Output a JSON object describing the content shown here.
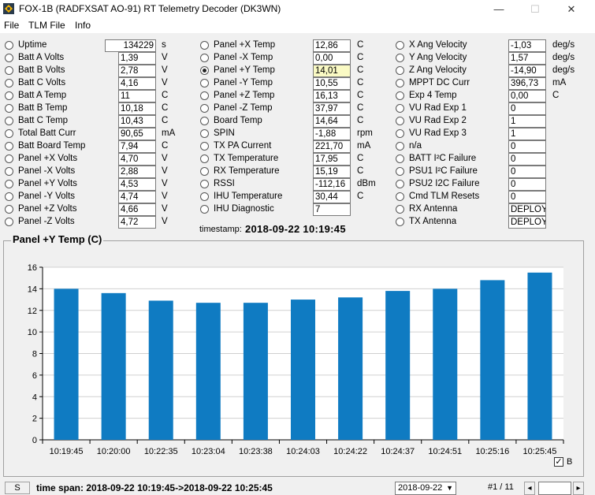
{
  "window": {
    "title": "FOX-1B (RADFXSAT AO-91) RT Telemetry Decoder  (DK3WN)",
    "min_glyph": "—",
    "max_glyph": "☐",
    "close_glyph": "✕"
  },
  "menu": [
    "File",
    "TLM File",
    "Info"
  ],
  "col1": [
    {
      "label": "Uptime",
      "value": "134229",
      "unit": "s"
    },
    {
      "label": "Batt A Volts",
      "value": "1,39",
      "unit": "V"
    },
    {
      "label": "Batt B Volts",
      "value": "2,78",
      "unit": "V"
    },
    {
      "label": "Batt C Volts",
      "value": "4,16",
      "unit": "V"
    },
    {
      "label": "Batt A Temp",
      "value": "11",
      "unit": "C"
    },
    {
      "label": "Batt B Temp",
      "value": "10,18",
      "unit": "C"
    },
    {
      "label": "Batt C Temp",
      "value": "10,43",
      "unit": "C"
    },
    {
      "label": "Total Batt Curr",
      "value": "90,65",
      "unit": "mA"
    },
    {
      "label": "Batt Board Temp",
      "value": "7,94",
      "unit": "C"
    },
    {
      "label": "Panel +X Volts",
      "value": "4,70",
      "unit": "V"
    },
    {
      "label": "Panel -X Volts",
      "value": "2,88",
      "unit": "V"
    },
    {
      "label": "Panel +Y Volts",
      "value": "4,53",
      "unit": "V"
    },
    {
      "label": "Panel -Y Volts",
      "value": "4,74",
      "unit": "V"
    },
    {
      "label": "Panel +Z Volts",
      "value": "4,66",
      "unit": "V"
    },
    {
      "label": "Panel -Z Volts",
      "value": "4,72",
      "unit": "V"
    }
  ],
  "col2": [
    {
      "label": "Panel +X Temp",
      "value": "12,86",
      "unit": "C"
    },
    {
      "label": "Panel -X Temp",
      "value": "0,00",
      "unit": "C"
    },
    {
      "label": "Panel +Y Temp",
      "value": "14,01",
      "unit": "C",
      "selected": true
    },
    {
      "label": "Panel -Y Temp",
      "value": "10,55",
      "unit": "C"
    },
    {
      "label": "Panel +Z Temp",
      "value": "16,13",
      "unit": "C"
    },
    {
      "label": "Panel -Z Temp",
      "value": "37,97",
      "unit": "C"
    },
    {
      "label": "Board Temp",
      "value": "14,64",
      "unit": "C"
    },
    {
      "label": "SPIN",
      "value": "-1,88",
      "unit": "rpm"
    },
    {
      "label": "TX PA Current",
      "value": "221,70",
      "unit": "mA"
    },
    {
      "label": "TX Temperature",
      "value": "17,95",
      "unit": "C"
    },
    {
      "label": "RX Temperature",
      "value": "15,19",
      "unit": "C"
    },
    {
      "label": "RSSI",
      "value": "-112,16",
      "unit": "dBm"
    },
    {
      "label": "IHU Temperature",
      "value": "30,44",
      "unit": "C"
    },
    {
      "label": "IHU Diagnostic",
      "value": "7",
      "unit": ""
    }
  ],
  "col3": [
    {
      "label": "X Ang Velocity",
      "value": "-1,03",
      "unit": "deg/s"
    },
    {
      "label": "Y Ang Velocity",
      "value": "1,57",
      "unit": "deg/s"
    },
    {
      "label": "Z Ang Velocity",
      "value": "-14,90",
      "unit": "deg/s"
    },
    {
      "label": "MPPT DC Curr",
      "value": "396,73",
      "unit": "mA"
    },
    {
      "label": "Exp 4 Temp",
      "value": "0,00",
      "unit": "C"
    },
    {
      "label": "VU Rad Exp 1",
      "value": "0",
      "unit": ""
    },
    {
      "label": "VU Rad Exp 2",
      "value": "1",
      "unit": ""
    },
    {
      "label": "VU Rad Exp 3",
      "value": "1",
      "unit": ""
    },
    {
      "label": "n/a",
      "value": "0",
      "unit": ""
    },
    {
      "label": "BATT I²C Failure",
      "value": "0",
      "unit": ""
    },
    {
      "label": "PSU1 I²C Failure",
      "value": "0",
      "unit": ""
    },
    {
      "label": "PSU2 I2C Failure",
      "value": "0",
      "unit": ""
    },
    {
      "label": "Cmd TLM Resets",
      "value": "0",
      "unit": ""
    },
    {
      "label": "RX Antenna",
      "value": "DEPLOY",
      "unit": ""
    },
    {
      "label": "TX Antenna",
      "value": "DEPLOY",
      "unit": ""
    }
  ],
  "timestamp": {
    "label": "timestamp:",
    "value": "2018-09-22  10:19:45"
  },
  "chart_data": {
    "type": "bar",
    "title": "Panel +Y Temp (C)",
    "categories": [
      "10:19:45",
      "10:20:00",
      "10:22:35",
      "10:23:04",
      "10:23:38",
      "10:24:03",
      "10:24:22",
      "10:24:37",
      "10:24:51",
      "10:25:16",
      "10:25:45"
    ],
    "series": [
      {
        "name": "B",
        "values": [
          14.0,
          13.6,
          12.9,
          12.7,
          12.7,
          13.0,
          13.2,
          13.8,
          14.0,
          14.8,
          15.5
        ]
      }
    ],
    "ylim": [
      0,
      16
    ],
    "yticks": [
      0,
      2,
      4,
      6,
      8,
      10,
      12,
      14,
      16
    ],
    "bar_color": "#0f7bc2",
    "grid": true,
    "legend": "bottom-right"
  },
  "status": {
    "s_button": "S",
    "timespan": "time span: 2018-09-22 10:19:45->2018-09-22 10:25:45",
    "date": "2018-09-22",
    "page": "#1 / 11"
  }
}
